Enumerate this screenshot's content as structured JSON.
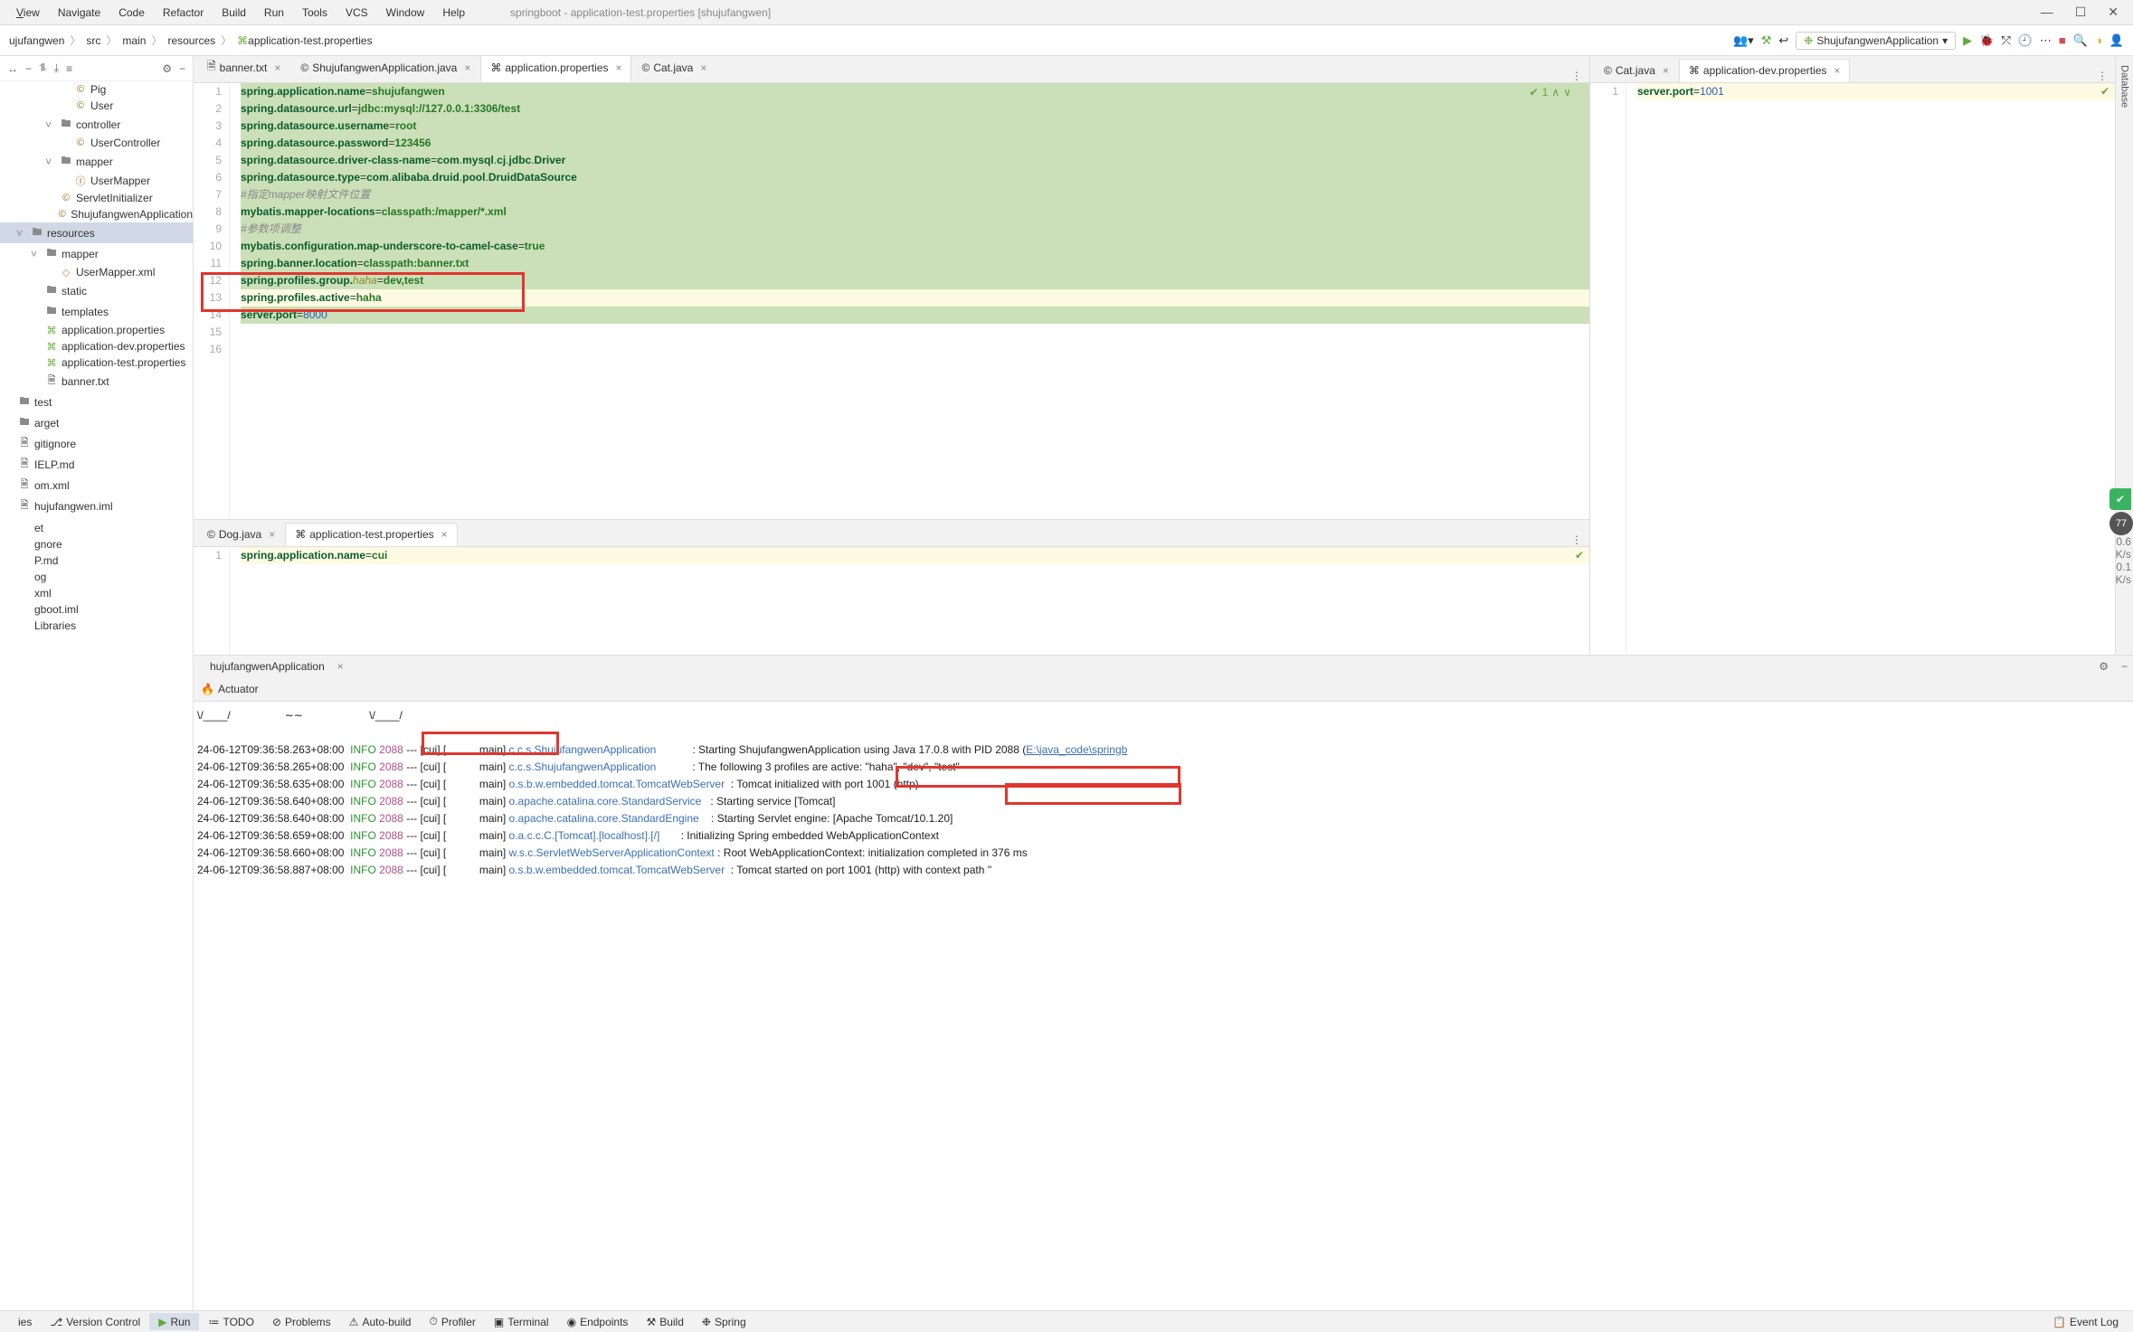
{
  "window": {
    "title": "springboot - application-test.properties [shujufangwen]"
  },
  "menu": {
    "view": "View",
    "navigate": "Navigate",
    "code": "Code",
    "refactor": "Refactor",
    "build": "Build",
    "run": "Run",
    "tools": "Tools",
    "vcs": "VCS",
    "window": "Window",
    "help": "Help"
  },
  "crumbs": [
    "ujufangwen",
    "src",
    "main",
    "resources",
    "application-test.properties"
  ],
  "run_config": "ShujufangwenApplication",
  "toolbar_icons": {
    "hammer": "⚒",
    "back": "↩",
    "play": "▶",
    "bug": "🐞",
    "cover": "⤱",
    "more": "…",
    "stop": "■",
    "search": "🔍",
    "assist": "◑",
    "user": "👤"
  },
  "tree_tool_icons": [
    "☰",
    "−",
    "⤢",
    "⇲",
    "↧",
    "⚙",
    "−"
  ],
  "tree": [
    {
      "indent": 4,
      "arrow": "",
      "icon": "©",
      "iconCls": "java-icon",
      "label": "Pig"
    },
    {
      "indent": 4,
      "arrow": "",
      "icon": "©",
      "iconCls": "java-icon",
      "label": "User"
    },
    {
      "indent": 3,
      "arrow": "˅",
      "icon": "🖿",
      "iconCls": "folder-icon",
      "label": "controller"
    },
    {
      "indent": 4,
      "arrow": "",
      "icon": "©",
      "iconCls": "java-icon",
      "label": "UserController"
    },
    {
      "indent": 3,
      "arrow": "˅",
      "icon": "🖿",
      "iconCls": "folder-icon",
      "label": "mapper"
    },
    {
      "indent": 4,
      "arrow": "",
      "icon": "Ⓘ",
      "iconCls": "java-icon",
      "label": "UserMapper"
    },
    {
      "indent": 3,
      "arrow": "",
      "icon": "©",
      "iconCls": "java-icon",
      "label": "ServletInitializer"
    },
    {
      "indent": 3,
      "arrow": "",
      "icon": "©",
      "iconCls": "java-icon",
      "label": "ShujufangwenApplication"
    },
    {
      "indent": 1,
      "arrow": "˅",
      "icon": "🖿",
      "iconCls": "folder-icon",
      "label": "resources",
      "selected": true
    },
    {
      "indent": 2,
      "arrow": "˅",
      "icon": "🖿",
      "iconCls": "folder-icon",
      "label": "mapper"
    },
    {
      "indent": 3,
      "arrow": "",
      "icon": "◇",
      "iconCls": "xml-icon",
      "label": "UserMapper.xml"
    },
    {
      "indent": 2,
      "arrow": "",
      "icon": "🖿",
      "iconCls": "folder-icon",
      "label": "static"
    },
    {
      "indent": 2,
      "arrow": "",
      "icon": "🖿",
      "iconCls": "folder-icon",
      "label": "templates"
    },
    {
      "indent": 2,
      "arrow": "",
      "icon": "⌘",
      "iconCls": "prop-icon",
      "label": "application.properties"
    },
    {
      "indent": 2,
      "arrow": "",
      "icon": "⌘",
      "iconCls": "prop-icon",
      "label": "application-dev.properties"
    },
    {
      "indent": 2,
      "arrow": "",
      "icon": "⌘",
      "iconCls": "prop-icon",
      "label": "application-test.properties"
    },
    {
      "indent": 2,
      "arrow": "",
      "icon": "🗎",
      "iconCls": "",
      "label": "banner.txt"
    },
    {
      "indent": 0,
      "arrow": "",
      "icon": "🖿",
      "iconCls": "folder-icon",
      "label": "test"
    },
    {
      "indent": 0,
      "arrow": "",
      "icon": "🖿",
      "iconCls": "folder-icon",
      "label": "arget"
    },
    {
      "indent": 0,
      "arrow": "",
      "icon": "🗎",
      "iconCls": "",
      "label": "gitignore"
    },
    {
      "indent": 0,
      "arrow": "",
      "icon": "🗎",
      "iconCls": "",
      "label": "IELP.md"
    },
    {
      "indent": 0,
      "arrow": "",
      "icon": "🗎",
      "iconCls": "",
      "label": "om.xml"
    },
    {
      "indent": 0,
      "arrow": "",
      "icon": "🗎",
      "iconCls": "",
      "label": "hujufangwen.iml"
    },
    {
      "indent": 0,
      "arrow": "",
      "icon": "",
      "iconCls": "",
      "label": ""
    },
    {
      "indent": 0,
      "arrow": "",
      "icon": "",
      "iconCls": "",
      "label": "et"
    },
    {
      "indent": 0,
      "arrow": "",
      "icon": "",
      "iconCls": "",
      "label": "gnore"
    },
    {
      "indent": 0,
      "arrow": "",
      "icon": "",
      "iconCls": "",
      "label": "P.md"
    },
    {
      "indent": 0,
      "arrow": "",
      "icon": "",
      "iconCls": "",
      "label": "og"
    },
    {
      "indent": 0,
      "arrow": "",
      "icon": "",
      "iconCls": "",
      "label": "xml"
    },
    {
      "indent": 0,
      "arrow": "",
      "icon": "",
      "iconCls": "",
      "label": "gboot.iml"
    },
    {
      "indent": 0,
      "arrow": "",
      "icon": "",
      "iconCls": "",
      "label": "Libraries"
    }
  ],
  "tabs_left_top": [
    {
      "icon": "🗎",
      "label": "banner.txt",
      "active": false
    },
    {
      "icon": "©",
      "label": "ShujufangwenApplication.java",
      "active": false
    },
    {
      "icon": "⌘",
      "label": "application.properties",
      "active": true
    },
    {
      "icon": "©",
      "label": "Cat.java",
      "active": false
    }
  ],
  "tabs_right_top": [
    {
      "icon": "©",
      "label": "Cat.java",
      "active": false
    },
    {
      "icon": "⌘",
      "label": "application-dev.properties",
      "active": true
    }
  ],
  "tabs_left_bottom": [
    {
      "icon": "©",
      "label": "Dog.java",
      "active": false
    },
    {
      "icon": "⌘",
      "label": "application-test.properties",
      "active": true
    }
  ],
  "editor_status_left": {
    "check": "✔",
    "num": "1",
    "up": "∧",
    "down": "∨"
  },
  "editor_main": {
    "lines": [
      {
        "n": 1,
        "bg": "c-changed",
        "html": "<span class='tok-key'>spring.application.name</span>=<span class='tok-val'>shujufangwen</span>"
      },
      {
        "n": 2,
        "bg": "c-changed",
        "html": "<span class='tok-key'>spring.datasource.url</span>=<span class='tok-val'>jdbc:mysql://127.0.0.1:3306/test</span>"
      },
      {
        "n": 3,
        "bg": "c-changed",
        "html": "<span class='tok-key'>spring.datasource.username</span>=<span class='tok-val'>root</span>"
      },
      {
        "n": 4,
        "bg": "c-changed",
        "html": "<span class='tok-key'>spring.datasource.password</span>=<span class='tok-val'>123456</span>"
      },
      {
        "n": 5,
        "bg": "c-changed",
        "html": "<span class='tok-key'>spring.datasource.driver-class-name</span>=<span class='tok-key'>com</span>.<span class='tok-key'>mysql</span>.<span class='tok-key'>cj</span>.<span class='tok-key'>jdbc</span>.<span class='tok-key'>Driver</span>"
      },
      {
        "n": 6,
        "bg": "c-changed",
        "html": "<span class='tok-key'>spring.datasource.type</span>=<span class='tok-key'>com</span>.<span class='tok-key'>alibaba</span>.<span class='tok-key'>druid</span>.<span class='tok-key'>pool</span>.<span class='tok-key'>DruidDataSource</span>"
      },
      {
        "n": 7,
        "bg": "c-changed",
        "html": "<span class='tok-comment'>#指定mapper映射文件位置</span>"
      },
      {
        "n": 8,
        "bg": "c-changed",
        "html": "<span class='tok-key'>mybatis.mapper-locations</span>=<span class='tok-val'>classpath:/mapper/*.xml</span>"
      },
      {
        "n": 9,
        "bg": "c-changed",
        "html": "<span class='tok-comment'>#参数项调整</span>"
      },
      {
        "n": 10,
        "bg": "c-changed",
        "html": "<span class='tok-key'>mybatis.configuration.map-underscore-to-camel-case</span>=<span class='tok-val'>true</span>"
      },
      {
        "n": 11,
        "bg": "c-changed",
        "html": "<span class='tok-key'>spring.banner.location</span>=<span class='tok-val'>classpath:banner.txt</span>"
      },
      {
        "n": 12,
        "bg": "c-changed",
        "html": "<span class='tok-key'>spring.profiles.group.</span><span class='tok-param'>haha</span>=<span class='tok-val'>dev,test</span>",
        "hi": "r1start"
      },
      {
        "n": 13,
        "bg": "c-cur-line",
        "html": "<span class='tok-key'>spring.profiles.active</span>=<span class='tok-val'>haha</span>"
      },
      {
        "n": 14,
        "bg": "c-changed",
        "html": "<span class='tok-key'>server.port</span>=<span class='tok-num'>8000</span>"
      },
      {
        "n": 15,
        "bg": "",
        "html": ""
      },
      {
        "n": 16,
        "bg": "",
        "html": ""
      }
    ]
  },
  "editor_right": {
    "n": 1,
    "html": "<span class='tok-key'>server.port</span>=<span class='tok-num'>1001</span>"
  },
  "editor_sub_left": {
    "n": 1,
    "html": "<span class='tok-key'>spring.application.name</span>=<span class='tok-val'>cui</span>"
  },
  "nav_tab": {
    "label": "hujufangwenApplication"
  },
  "actuator": {
    "label": "Actuator",
    "icon": "🔥"
  },
  "console_ascii": {
    "left": "\\/____/",
    "mid": "∼∼",
    "right": "\\/____/"
  },
  "console": [
    {
      "ts": "24-06-12T09:36:58.263+08:00",
      "pid": "2088",
      "thread": "--- [cui] [           main] ",
      "class": "c.c.s.ShujufangwenApplication            ",
      "msg": ": Starting ShujufangwenApplication using Java 17.0.8 with PID 2088 (",
      "link": "E:\\java_code\\springb"
    },
    {
      "ts": "24-06-12T09:36:58.265+08:00",
      "pid": "2088",
      "thread": "--- [cui] [           main] ",
      "class": "c.c.s.ShujufangwenApplication            ",
      "msg": ": The following 3 profiles are active: \"haha\", \"dev\", \"test\""
    },
    {
      "ts": "24-06-12T09:36:58.635+08:00",
      "pid": "2088",
      "thread": "--- [cui] [           main] ",
      "class": "o.s.b.w.embedded.tomcat.TomcatWebServer  ",
      "msg": ": Tomcat initialized with port 1001 (http)"
    },
    {
      "ts": "24-06-12T09:36:58.640+08:00",
      "pid": "2088",
      "thread": "--- [cui] [           main] ",
      "class": "o.apache.catalina.core.StandardService   ",
      "msg": ": Starting service [Tomcat]"
    },
    {
      "ts": "24-06-12T09:36:58.640+08:00",
      "pid": "2088",
      "thread": "--- [cui] [           main] ",
      "class": "o.apache.catalina.core.StandardEngine    ",
      "msg": ": Starting Servlet engine: [Apache Tomcat/10.1.20]"
    },
    {
      "ts": "24-06-12T09:36:58.659+08:00",
      "pid": "2088",
      "thread": "--- [cui] [           main] ",
      "class": "o.a.c.c.C.[Tomcat].[localhost].[/]       ",
      "msg": ": Initializing Spring embedded WebApplicationContext"
    },
    {
      "ts": "24-06-12T09:36:58.660+08:00",
      "pid": "2088",
      "thread": "--- [cui] [           main] ",
      "class": "w.s.c.ServletWebServerApplicationContext ",
      "msg": ": Root WebApplicationContext: initialization completed in 376 ms"
    },
    {
      "ts": "24-06-12T09:36:58.887+08:00",
      "pid": "2088",
      "thread": "--- [cui] [           main] ",
      "class": "o.s.b.w.embedded.tomcat.TomcatWebServer  ",
      "msg": ": Tomcat started on port 1001 (http) with context path ''"
    }
  ],
  "bottom_bar": {
    "items": [
      {
        "icon": "",
        "label": "ies"
      },
      {
        "icon": "⎇",
        "label": "Version Control"
      },
      {
        "icon": "▶",
        "label": "Run",
        "active": true,
        "cls": "icon-play"
      },
      {
        "icon": "≔",
        "label": "TODO"
      },
      {
        "icon": "⊘",
        "label": "Problems"
      },
      {
        "icon": "⚠",
        "label": "Auto-build"
      },
      {
        "icon": "⏱",
        "label": "Profiler"
      },
      {
        "icon": "▣",
        "label": "Terminal"
      },
      {
        "icon": "◉",
        "label": "Endpoints"
      },
      {
        "icon": "⚒",
        "label": "Build"
      },
      {
        "icon": "❉",
        "label": "Spring"
      }
    ],
    "event_log": "Event Log"
  },
  "side_tabs_right": [
    "Database",
    "⋮"
  ],
  "perf": {
    "shield": "✔",
    "score": "77",
    "k1": "0.6",
    "u1": "K/s",
    "k2": "0.1",
    "u2": "K/s"
  }
}
